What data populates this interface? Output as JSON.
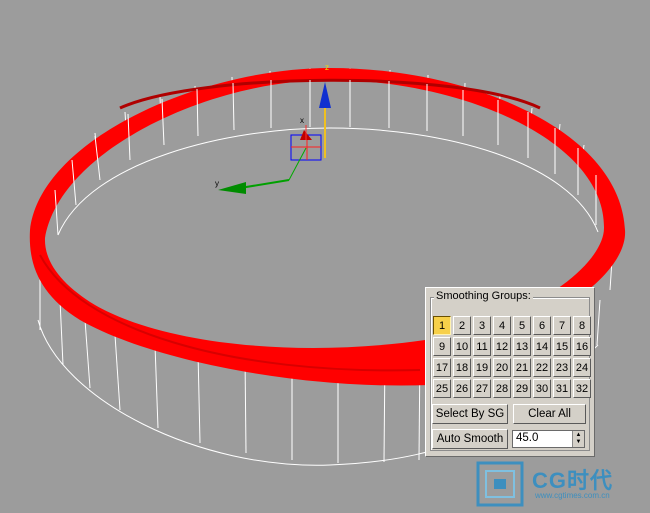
{
  "panel": {
    "title": "Smoothing Groups:",
    "groups": [
      "1",
      "2",
      "3",
      "4",
      "5",
      "6",
      "7",
      "8",
      "9",
      "10",
      "11",
      "12",
      "13",
      "14",
      "15",
      "16",
      "17",
      "18",
      "19",
      "20",
      "21",
      "22",
      "23",
      "24",
      "25",
      "26",
      "27",
      "28",
      "29",
      "30",
      "31",
      "32"
    ],
    "active_group": "1",
    "select_by_sg_label": "Select By SG",
    "clear_all_label": "Clear All",
    "auto_smooth_label": "Auto Smooth",
    "threshold_value": "45.0"
  },
  "viewport": {
    "background_color": "#9c9c9c",
    "ring_color": "#ff0000",
    "wire_color": "#ffffff",
    "gizmo_labels": {
      "z": "z",
      "x": "x",
      "y": "y"
    }
  },
  "watermark": {
    "brand": "CG时代",
    "url": "www.cgtimes.com.cn"
  }
}
